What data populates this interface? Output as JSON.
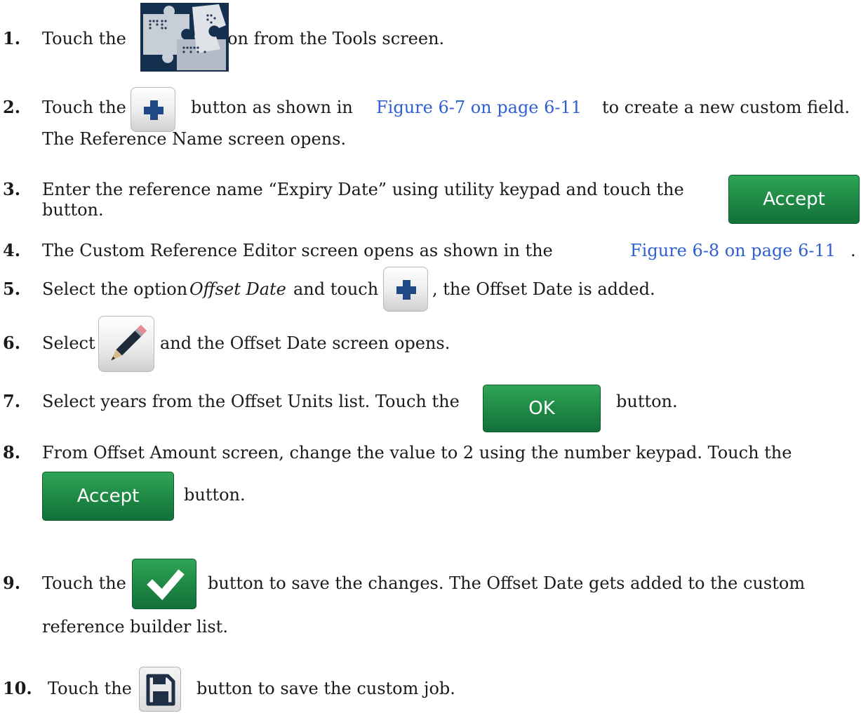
{
  "steps": [
    {
      "num": "1.",
      "before": "Touch the",
      "after": "button from the Tools screen."
    },
    {
      "num": "2.",
      "before": "Touch the",
      "mid": "button as shown in",
      "link": "Figure 6-7 on page 6-11",
      "after": "to create a new custom field.",
      "line2": "The Reference Name screen opens."
    },
    {
      "num": "3.",
      "text": "Enter the reference name “Expiry Date” using utility keypad and touch the",
      "line2": "button."
    },
    {
      "num": "4.",
      "before": "The Custom Reference Editor screen opens as shown in the",
      "link": "Figure 6-8 on page 6-11",
      "after": "."
    },
    {
      "num": "5.",
      "before": "Select the option",
      "italic": "Offset Date",
      "mid": "and touch",
      "after": ", the Offset Date is added."
    },
    {
      "num": "6.",
      "before": "Select",
      "after": "and the Offset Date screen opens."
    },
    {
      "num": "7.",
      "before": "Select years from the Offset Units list. Touch the",
      "after": "button."
    },
    {
      "num": "8.",
      "text": "From Offset Amount screen, change the value to 2 using the number keypad. Touch the",
      "line2": "button."
    },
    {
      "num": "9.",
      "before": "Touch the",
      "after": "button to save the changes. The Offset Date gets added to the custom",
      "line2": "reference builder list."
    },
    {
      "num": "10.",
      "before": "Touch the",
      "after": "button to save the custom job."
    }
  ],
  "buttons": {
    "accept": "Accept",
    "ok": "OK"
  },
  "icons": {
    "tools_puzzle": "puzzle-icon",
    "plus": "plus-icon",
    "pencil": "pencil-icon",
    "check": "checkmark-icon",
    "save": "floppy-disk-icon"
  },
  "colors": {
    "link": "#2f5fd0",
    "green_button": "#1f8a45",
    "puzzle_bg": "#15304f"
  }
}
